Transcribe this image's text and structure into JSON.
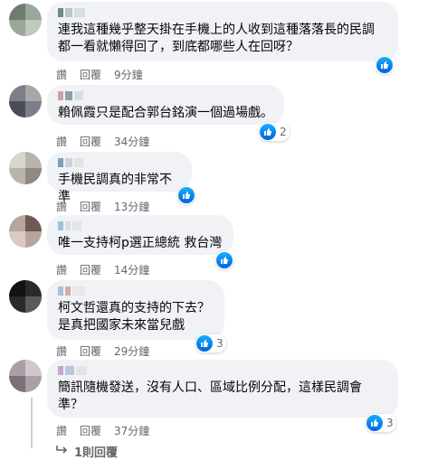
{
  "comments": [
    {
      "text": "連我這種幾乎整天掛在手機上的人收到這種落落長的民調\n都一看就懶得回了，到底都哪些人在回呀？",
      "like_label": "讚",
      "reply_label": "回覆",
      "time": "9分鐘",
      "reaction_count": ""
    },
    {
      "text": "賴佩霞只是配合郭台銘演一個過場戲。",
      "like_label": "讚",
      "reply_label": "回覆",
      "time": "34分鐘",
      "reaction_count": "2"
    },
    {
      "text": "手機民調真的非常不準",
      "like_label": "讚",
      "reply_label": "回覆",
      "time": "13分鐘",
      "reaction_count": ""
    },
    {
      "text": "唯一支持柯p選正總統 救台灣",
      "like_label": "讚",
      "reply_label": "回覆",
      "time": "14分鐘",
      "reaction_count": ""
    },
    {
      "text": "柯文哲還真的支持的下去？\n是真把國家未來當兒戲",
      "like_label": "讚",
      "reply_label": "回覆",
      "time": "29分鐘",
      "reaction_count": "3"
    },
    {
      "text": "簡訊隨機發送，沒有人口、區域比例分配，這樣民調會\n準？",
      "like_label": "讚",
      "reply_label": "回覆",
      "time": "37分鐘",
      "reaction_count": "3"
    }
  ],
  "replies_link": "1則回覆",
  "icons": {
    "like": "thumbs-up-icon",
    "reply_arrow": "reply-arrow-icon"
  },
  "colors": {
    "bubble": "#f0f2f5",
    "meta": "#65676b",
    "like_blue": "#1877f2"
  }
}
